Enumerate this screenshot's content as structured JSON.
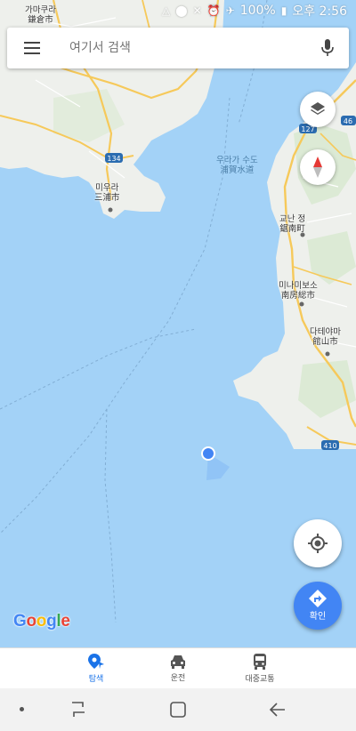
{
  "status_bar": {
    "battery": "100%",
    "time": "오후 2:56",
    "icons": [
      "nav-arrow-icon",
      "location-icon",
      "mute-icon",
      "alarm-icon",
      "airplane-icon",
      "battery-icon"
    ]
  },
  "search": {
    "placeholder": "여기서 검색",
    "menu_icon": "hamburger-menu-icon",
    "mic_icon": "microphone-icon"
  },
  "map": {
    "labels": {
      "kamakura_ko": "가마쿠라",
      "kamakura_ja": "鎌倉市",
      "miura_ko": "미우라",
      "miura_ja": "三浦市",
      "uraga_ko": "우라가 수도",
      "uraga_ja": "浦賀水道",
      "kyonan_ko": "교난 정",
      "kyonan_ja": "鋸南町",
      "minamiboso_ko": "미나미보소",
      "minamiboso_ja": "南房総市",
      "tateyama_ko": "다테야마",
      "tateyama_ja": "館山市"
    },
    "road_shields": [
      "134",
      "127",
      "46",
      "410"
    ],
    "colors": {
      "water": "#a3d2f7",
      "land": "#eef0ec",
      "road": "#f6c95a"
    }
  },
  "buttons": {
    "layers_icon": "layers-icon",
    "compass_icon": "compass-icon",
    "my_location_icon": "my-location-icon",
    "go_label": "확인",
    "go_icon": "directions-icon"
  },
  "logo": {
    "G": "G",
    "o1": "o",
    "o2": "o",
    "g": "g",
    "l": "l",
    "e": "e"
  },
  "bottom_nav": {
    "tabs": [
      {
        "label": "탐색",
        "icon": "explore-pin-icon",
        "active": true
      },
      {
        "label": "운전",
        "icon": "car-icon",
        "active": false
      },
      {
        "label": "대중교통",
        "icon": "bus-icon",
        "active": false
      }
    ]
  },
  "system_nav": [
    "recent-apps-icon",
    "home-icon",
    "back-icon"
  ]
}
